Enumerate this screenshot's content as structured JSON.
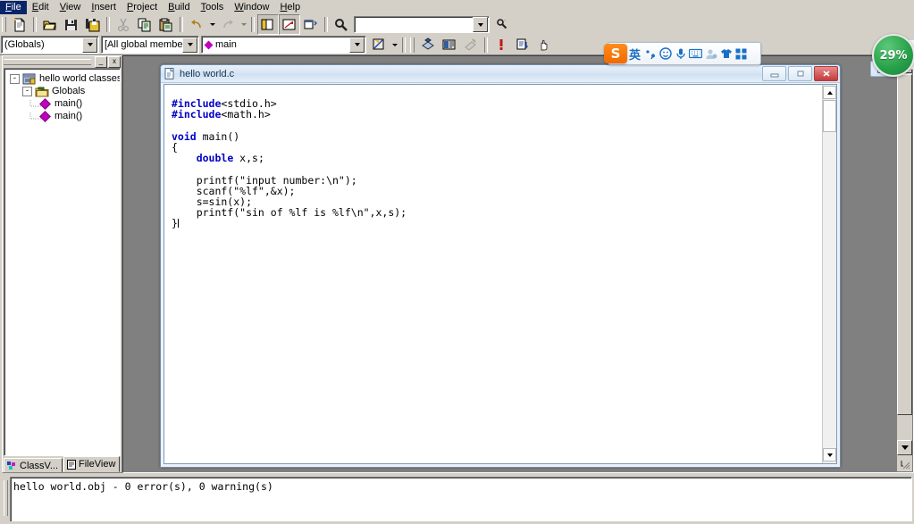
{
  "menu": {
    "items": [
      "File",
      "Edit",
      "View",
      "Insert",
      "Project",
      "Build",
      "Tools",
      "Window",
      "Help"
    ]
  },
  "toolbar_standard": {
    "buttons": [
      "new-text-file-icon",
      "open-icon",
      "save-icon",
      "save-all-icon",
      "cut-icon",
      "copy-icon",
      "paste-icon",
      "undo-icon",
      "redo-icon",
      "workspace-icon",
      "output-window-icon",
      "window-list-icon",
      "find-in-files-icon"
    ],
    "find_value": "",
    "find_placeholder": ""
  },
  "toolbar_wizard": {
    "class_combo": "(Globals)",
    "member_combo": "[All global members]",
    "symbol_combo": "main",
    "bookmark_icon": "toggle-bookmark-icon"
  },
  "toolbar_build": {
    "buttons": [
      "compile-icon",
      "build-icon",
      "stop-build-icon",
      "breakpoint-icon",
      "step-icon",
      "hand-icon"
    ]
  },
  "workspace": {
    "title": "",
    "min_button": "_",
    "close_button": "x",
    "tree": [
      {
        "label": "hello world classes",
        "toggle": "-",
        "icon": "project-classes-icon",
        "level": 0
      },
      {
        "label": "Globals",
        "toggle": "-",
        "icon": "folder-globals-icon",
        "level": 1
      },
      {
        "label": "main()",
        "toggle": "",
        "icon": "global-function-icon",
        "level": 2
      },
      {
        "label": "main()",
        "toggle": "",
        "icon": "global-function-icon",
        "level": 2
      }
    ],
    "tabs": [
      {
        "label": "ClassV...",
        "icon": "classview-icon",
        "active": false
      },
      {
        "label": "FileView",
        "icon": "fileview-icon",
        "active": true
      }
    ]
  },
  "code_window": {
    "title": "hello world.c",
    "icon": "c-source-file-icon",
    "minimize_label": "–",
    "restore_label": "❐",
    "close_label": "✕",
    "lines": [
      {
        "text": "#include<stdio.h>",
        "kw": "#include"
      },
      {
        "text": "#include<math.h>",
        "kw": "#include"
      },
      {
        "text": "",
        "kw": ""
      },
      {
        "text": "void main()",
        "kw": "void"
      },
      {
        "text": "{",
        "kw": ""
      },
      {
        "text": "    double x,s;",
        "kw": "double"
      },
      {
        "text": "",
        "kw": ""
      },
      {
        "text": "    printf(\"input number:\\n\");",
        "kw": ""
      },
      {
        "text": "    scanf(\"%lf\",&x);",
        "kw": ""
      },
      {
        "text": "    s=sin(x);",
        "kw": ""
      },
      {
        "text": "    printf(\"sin of %lf is %lf\\n\",x,s);",
        "kw": ""
      },
      {
        "text": "}",
        "kw": ""
      }
    ]
  },
  "mdi": {
    "close_box_icon": "restore-window-icon"
  },
  "output": {
    "text": "hello world.obj - 0 error(s), 0 warning(s)"
  },
  "ime": {
    "logo": "S",
    "mode_label": "英",
    "icons": [
      "comma-period-icon",
      "smiley-icon",
      "microphone-icon",
      "soft-keyboard-icon",
      "user-icon",
      "skin-shirt-icon",
      "toolbox-icon"
    ]
  },
  "badge": {
    "percent": "29%",
    "strip_top": "R",
    "strip_bottom": "G"
  },
  "colors": {
    "face": "#d4d0c8",
    "keyword": "#0000c8",
    "accent_magenta": "#c000c0",
    "badge_green": "#29a24a",
    "ime_blue": "#1a6fc4"
  }
}
